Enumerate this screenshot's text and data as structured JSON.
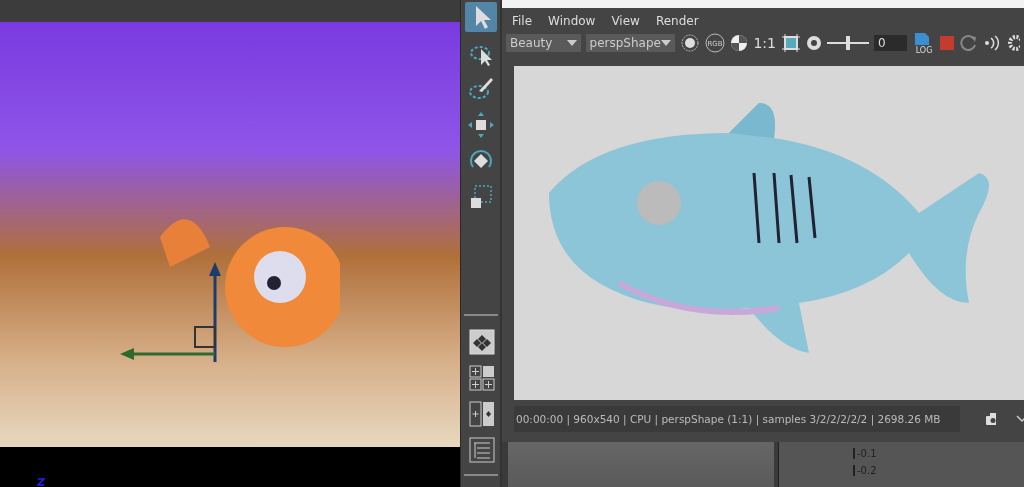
{
  "tools": [
    {
      "selected": true
    },
    {
      "selected": false
    },
    {
      "selected": false
    },
    {
      "selected": false
    },
    {
      "selected": false
    },
    {
      "selected": false
    }
  ],
  "render_view": {
    "menu": [
      "File",
      "Window",
      "View",
      "Render"
    ],
    "toolbar": {
      "aov_dropdown": "Beauty",
      "camera_dropdown": "perspShape",
      "rgb_label": "RGB",
      "ratio": "1:1",
      "exposure": {
        "level": 0.5
      },
      "exposure_value": "0",
      "log_label": "LOG"
    },
    "status_bar": "00:00:00 | 960x540 | CPU | perspShape (1:1) | samples 3/2/2/2/2/2 | 2698.26 MB"
  },
  "graph_editor": {
    "ticks": [
      "-0.1",
      "-0.2"
    ]
  }
}
